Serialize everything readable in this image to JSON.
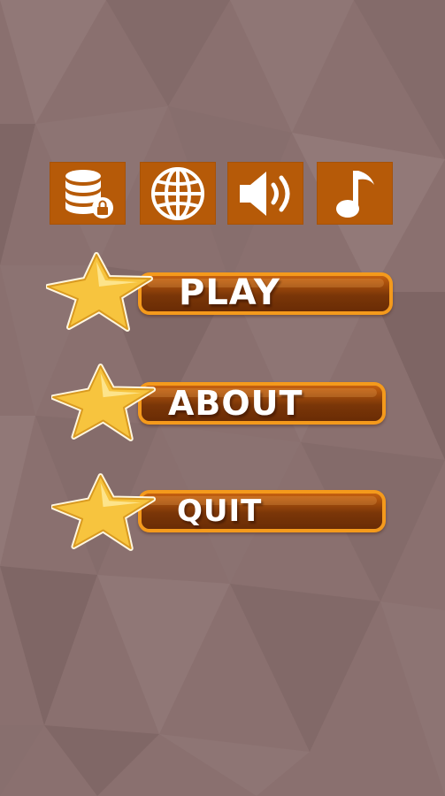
{
  "colors": {
    "background": "#8a706f",
    "icon_tile": "#b65a08",
    "bar_border": "#f49a1c",
    "star_fill": "#f7c43e",
    "label": "#ffffff"
  },
  "top_icons": [
    {
      "name": "database-lock-icon"
    },
    {
      "name": "globe-icon"
    },
    {
      "name": "speaker-volume-icon"
    },
    {
      "name": "music-note-icon"
    }
  ],
  "menu": {
    "play": "PLAY",
    "about": "ABOUT",
    "quit": "QUIT"
  }
}
